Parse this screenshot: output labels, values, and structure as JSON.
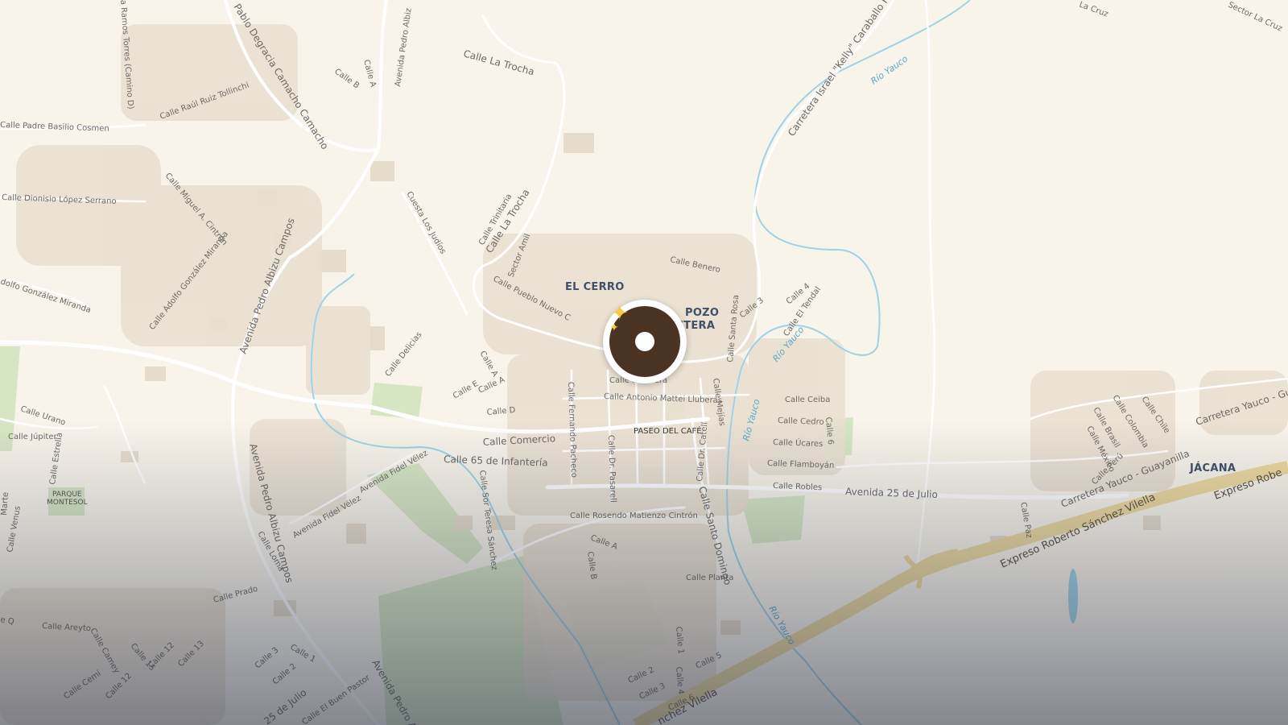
{
  "map": {
    "place_labels": {
      "el_cerro": "EL CERRO",
      "pozo_line1": "POZO",
      "pozo_line2": "NTERA",
      "jacana": "JÁCANA"
    },
    "poi_labels": {
      "paseo_del_cafe": "PASEO DEL CAFÉ",
      "parque_line1": "PARQUE",
      "parque_line2": "MONTESOL"
    },
    "rivers": {
      "rio_yauco_1": "Río Yauco",
      "rio_yauco_2": "Río Yauco",
      "rio_yauco_3": "Río Yauco",
      "rio_yauco_4": "Río Yauco"
    },
    "highways": {
      "expreso_1": "Expreso Roberto Sánchez Vilella",
      "expreso_2": "Expreso Robe",
      "expreso_3": "nchez Vilella"
    },
    "streets": {
      "calle_la_trocha_top": "Calle La Trocha",
      "calle_la_trocha_mid": "Calle La Trocha",
      "carretera_kelly": "Carretera Israel \"Kelly\" Caraballo Hernández",
      "calle_raul": "Calle Raúl Ruiz Tollinchi",
      "calle_padre": "Calle Padre Basilio Cosmen",
      "pablo_degracia": "Pablo Degracia Camacho Camacho",
      "av_pedro_top": "Avenida Pedro Albiz",
      "calle_b_top": "Calle B",
      "calle_a_top": "Calle A",
      "ramos_torres": "a Ramos Torres (Camino D)",
      "calle_dionisio": "Calle Dionisio López Serrano",
      "calle_miguel": "Calle Miguel A. Cintrón",
      "cuesta_judios": "Cuesta Los Judíos",
      "calle_trinitaria": "Calle Trinitaria",
      "sector_amil": "Sector Amil",
      "calle_pueblo_nuevo": "Calle Pueblo Nuevo C",
      "calle_benero": "Calle Benero",
      "calle_4": "Calle 4",
      "calle_3": "Calle 3",
      "calle_el_tendal": "Calle El Tendal",
      "calle_santa_rosa": "Calle Santa Rosa",
      "adolfo": "dolfo González Miranda",
      "calle_adolfo": "Calle Adolfo González Miranda",
      "av_pedro_mid": "Avenida Pedro Albizu Campos",
      "calle_delicias": "Calle Delicias",
      "calle_a_mid": "Calle A",
      "calle_a_mid2": "Calle A",
      "calle_e": "Calle E",
      "calle_d": "Calle D",
      "calle_rivera": "Calle        lo Rivera",
      "calle_antonio": "Calle Antonio Mattei Lluberas",
      "calle_mejias": "Calle Mejías",
      "calle_ceiba": "Calle Ceiba",
      "calle_cedro": "Calle Cedro",
      "calle_6": "Calle 6",
      "calle_ucares": "Calle Úcares",
      "calle_flamboyan": "Calle Flamboyán",
      "calle_robles": "Calle Robles",
      "calle_urano": "Calle Urano",
      "calle_jupiter": "Calle Júpiter",
      "calle_estrella": "Calle Estrella",
      "calle_comercio": "Calle Comercio",
      "calle_65": "Calle 65 de Infantería",
      "calle_fernando": "Calle Fernando Pacheco",
      "calle_dr_pasarell": "Calle Dr. Pasarell",
      "calle_dr_catell": "Calle Dr. Catell",
      "calle_santo_domingo": "Calle Santo Domingo",
      "av_25_julio": "Avenida 25 de Julio",
      "carretera_yauco_guay": "Carretera Yauco - Guayanilla",
      "carretera_yauco_gua": "Carretera Yauco - Gua",
      "calle_brasil": "Calle Brasil",
      "calle_colombia": "Calle Colombia",
      "calle_chile": "Calle Chile",
      "calle_mexico": "Calle México",
      "calle_peru": "Calle Perú",
      "calle_paz": "Calle Paz",
      "av_fidel_1": "Avenida Fidel Vélez",
      "av_fidel_2": "Avenida Fidel Vélez",
      "calle_sor_teresa": "Calle Sor Teresa Sánchez",
      "calle_rosendo": "Calle Rosendo Matienzo Cintrón",
      "calle_a_low": "Calle A",
      "calle_b_low": "Calle B",
      "calle_planta": "Calle Planta",
      "av_pedro_low": "Avenida Pedro Albizu Campos",
      "calle_loma": "Calle Loma",
      "calle_prado": "Calle Prado",
      "calle_venus": "Calle Venus",
      "calle_areyto": "Calle Areyto",
      "calle_camey": "Calle Camey",
      "calle_1_low": "Calle 1",
      "calle_5_low": "Calle 5",
      "calle_2_low": "Calle 2",
      "calle_3_low": "Calle 3",
      "calle_6_low": "Calle 6",
      "calle_4_low": "Calle 4",
      "calle_2_left": "Calle 2",
      "calle_3_left": "Calle 3",
      "calle_1_left": "Calle 1",
      "av_pedro_bottom": "Avenida Pedro Alb",
      "av_25_bottom": "25 de Julio",
      "calle_el_buen": "Calle El Buen Pastor",
      "calle_12": "Calle 12",
      "calle_13": "Calle 13",
      "calle_15": "Calle 15",
      "calle_12b": "Calle 12",
      "calle_cemi": "Calle Cemí",
      "sector_la_cruz": "Sector La Cruz",
      "la_cruz": "La Cruz",
      "calle_q": "e Q",
      "marte": "Marte"
    },
    "marker": {
      "icon": "coffee-donut-sparkle-icon"
    },
    "colors": {
      "background": "#f8f4ea",
      "road": "#ffffff",
      "highway": "#ecd9a0",
      "river": "#9fd2e6",
      "park": "#d6e6c4",
      "building": "#e6dccb",
      "marker": "#4a3323"
    }
  }
}
